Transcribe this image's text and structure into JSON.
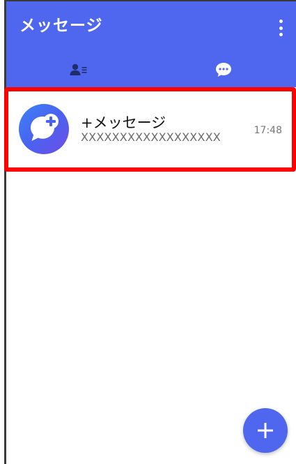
{
  "header": {
    "title": "メッセージ",
    "background_color": "#4f67ee"
  },
  "tabs": [
    {
      "id": "contacts",
      "icon": "contacts-icon",
      "selected": false
    },
    {
      "id": "messages",
      "icon": "chat-bubble-icon",
      "selected": true
    }
  ],
  "conversations": [
    {
      "name": "+メッセージ",
      "preview": "XXXXXXXXXXXXXXXXXX",
      "time": "17:48",
      "avatar_icon": "plus-message-logo-icon"
    }
  ],
  "fab": {
    "icon": "plus-icon",
    "color": "#4f67ee"
  },
  "highlight": {
    "color": "#ff0000",
    "target": "conversation-item"
  }
}
